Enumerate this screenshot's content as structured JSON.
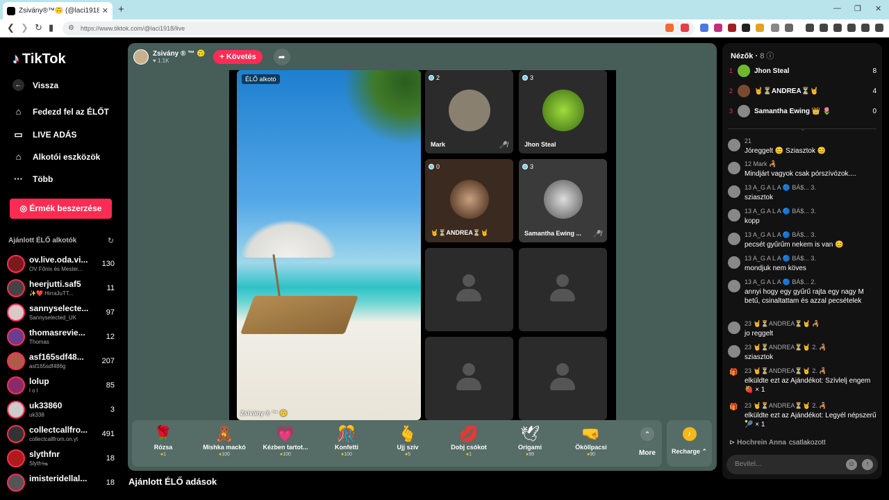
{
  "browser": {
    "tab_title": "Zsivány®™🙃 (@laci1918) Él…",
    "url": "https://www.tiktok.com/@laci1918/live"
  },
  "sidebar": {
    "logo": "TikTok",
    "back": "Vissza",
    "nav": [
      "Fedezd fel az ÉLŐT",
      "LIVE ADÁS",
      "Alkotói eszközök",
      "Több"
    ],
    "coins_button": "Érmék beszerzése",
    "recommended_title": "Ajánlott ÉLŐ alkotók",
    "creators": [
      {
        "name": "ov.live.oda.vi...",
        "sub": "OV Főnix és Mester...",
        "count": "130",
        "color": "#7a1a1a"
      },
      {
        "name": "heerjutti.saf5",
        "sub": "✨❤️ HirraJuTT...",
        "count": "11",
        "color": "#444"
      },
      {
        "name": "sannyselecte...",
        "sub": "Sannyselected_UK",
        "count": "97",
        "color": "#d9c9c9"
      },
      {
        "name": "thomasrevie...",
        "sub": "Thomas",
        "count": "12",
        "color": "#6a3d8f"
      },
      {
        "name": "asf165sdf48...",
        "sub": "asf165sdf486g",
        "count": "207",
        "color": "#b05a4a"
      },
      {
        "name": "lolup",
        "sub": "l o l",
        "count": "85",
        "color": "#8a2a6a"
      },
      {
        "name": "uk33860",
        "sub": "uk338",
        "count": "3",
        "color": "#ccc"
      },
      {
        "name": "collectcallfro...",
        "sub": "collectcallfrom.on.yt",
        "count": "491",
        "color": "#333"
      },
      {
        "name": "slythfnr",
        "sub": "Slyth🐜",
        "count": "18",
        "color": "#b01a1a"
      },
      {
        "name": "imisteridellal...",
        "sub": "",
        "count": "18",
        "color": "#555"
      }
    ]
  },
  "host": {
    "name": "Zsivány ® ™ 🙃",
    "likes": "♥ 1.1K",
    "follow": "+ Követés"
  },
  "stage": {
    "label": "ÉLŐ alkotó",
    "host_tag": "Zsivány ® ™ 🙃",
    "guests": [
      {
        "name": "Mark",
        "badge": "2",
        "muted": true,
        "color": "#8a8070"
      },
      {
        "name": "Jhon Steal",
        "badge": "3",
        "muted": false,
        "color": "#6fb82e"
      },
      {
        "name": "🤘⏳ANDREA⏳🤘",
        "badge": "0",
        "muted": false,
        "color": "#7a4a30"
      },
      {
        "name": "Samantha Ewing ...",
        "badge": "3",
        "muted": true,
        "color": "#777"
      }
    ]
  },
  "gifts": [
    {
      "name": "Rózsa",
      "price": "1",
      "icon": "🌹"
    },
    {
      "name": "Mishka mackó",
      "price": "100",
      "icon": "🧸"
    },
    {
      "name": "Kézben tartot...",
      "price": "100",
      "icon": "💗"
    },
    {
      "name": "Konfetti",
      "price": "100",
      "icon": "🎊"
    },
    {
      "name": "Ujj szív",
      "price": "5",
      "icon": "🫰"
    },
    {
      "name": "Dobj csókot",
      "price": "1",
      "icon": "💋"
    },
    {
      "name": "Origami",
      "price": "99",
      "icon": "🕊"
    },
    {
      "name": "Ököllpacsi",
      "price": "90",
      "icon": "🤜"
    }
  ],
  "more_label": "More",
  "recharge_label": "Recharge ⌃",
  "recommended_lives": "Ajánlott ÉLŐ adások",
  "viewers": {
    "title": "Nézők",
    "count": "8",
    "list": [
      {
        "rank": "1",
        "name": "Jhon Steal",
        "score": "8",
        "color": "#6fb82e"
      },
      {
        "rank": "2",
        "name": "🤘⏳ANDREA⏳🤘",
        "score": "4",
        "color": "#7a4a30"
      },
      {
        "rank": "3",
        "name": "Samantha Ewing 👑 🌷",
        "score": "0",
        "color": "#888"
      }
    ]
  },
  "chat": [
    {
      "head": "21",
      "text": "Jóreggelt 😊 Sziasztok 😊"
    },
    {
      "head": "12 Mark 🦂",
      "text": "Mindjárt vagyok csak pórszívózok...."
    },
    {
      "head": "13 A_G A L A 🔵 BÁ$... 3.",
      "text": "sziasztok"
    },
    {
      "head": "13 A_G A L A 🔵 BÁ$... 3.",
      "text": "kopp"
    },
    {
      "head": "13 A_G A L A 🔵 BÁ$... 3.",
      "text": "pecsét gyűrűm nekem is van 😊"
    },
    {
      "head": "13 A_G A L A 🔵 BÁ$... 3.",
      "text": "mondjuk nem köves"
    },
    {
      "head": "13 A_G A L A 🔵 BÁ$... 2.",
      "text": "annyi hogy egy gyűrű rajta egy nagy M betű, csinaltattam és azzal pecsételek"
    },
    {
      "head": "23 🤘⏳ANDREA⏳🤘 🦂",
      "text": "jo reggelt"
    },
    {
      "head": "23 🤘⏳ANDREA⏳🤘 2. 🦂",
      "text": "sziasztok"
    },
    {
      "head": "23 🤘⏳ANDREA⏳🤘 2. 🦂",
      "text": "elküldte ezt az Ajándékot: Szívlelj engem 🍓 × 1"
    },
    {
      "head": "23 🤘⏳ANDREA⏳🤘 2. 🦂",
      "text": "elküldte ezt az Ajándékot: Legyél népszerű 🎾 × 1"
    }
  ],
  "join": {
    "name": "Hochrein Anna",
    "text": "csatlakozott"
  },
  "input_placeholder": "Bevitel..."
}
